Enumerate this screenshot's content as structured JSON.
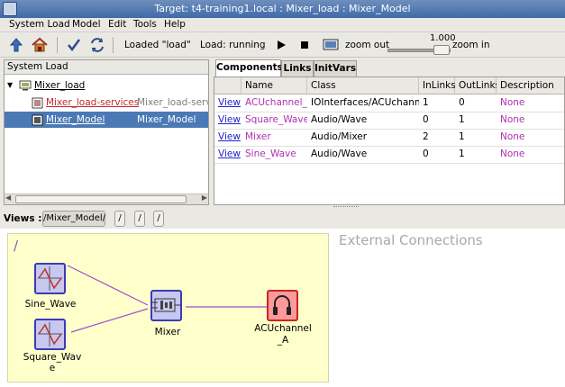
{
  "window": {
    "title": "Target: t4-training1.local : Mixer_load : Mixer_Model"
  },
  "menu": [
    "System Load",
    "Model",
    "Edit",
    "Tools",
    "Help"
  ],
  "toolbar": {
    "loaded_text": "Loaded \"load\"",
    "load_status": "Load: running",
    "zoom_out": "zoom out",
    "zoom_in": "zoom in",
    "zoom_value": "1.000",
    "zoom_level": 0.72
  },
  "left_panel": {
    "header": "System Load",
    "tree": [
      {
        "label": "Mixer_load",
        "secondary": ""
      },
      {
        "label": "Mixer_load-services",
        "secondary": "Mixer_load-service"
      },
      {
        "label": "Mixer_Model",
        "secondary": "Mixer_Model"
      }
    ]
  },
  "tabs": [
    "Components",
    "Links",
    "InitVars"
  ],
  "table": {
    "columns": [
      "",
      "Name",
      "Class",
      "InLinks",
      "OutLinks",
      "Description"
    ],
    "rows": [
      {
        "action": "View",
        "name": "ACUchannel_A",
        "class": "IOInterfaces/ACUchannel",
        "inlinks": "1",
        "outlinks": "0",
        "description": "None"
      },
      {
        "action": "View",
        "name": "Square_Wave",
        "class": "Audio/Wave",
        "inlinks": "0",
        "outlinks": "1",
        "description": "None"
      },
      {
        "action": "View",
        "name": "Mixer",
        "class": "Audio/Mixer",
        "inlinks": "2",
        "outlinks": "1",
        "description": "None"
      },
      {
        "action": "View",
        "name": "Sine_Wave",
        "class": "Audio/Wave",
        "inlinks": "0",
        "outlinks": "1",
        "description": "None"
      }
    ]
  },
  "views": {
    "label": "Views :",
    "buttons": [
      "/Mixer_Model/",
      "/",
      "/",
      "/"
    ]
  },
  "diagram": {
    "path_label": "/",
    "external_title": "External Connections",
    "nodes": [
      {
        "label": "Sine_Wave",
        "icon": "wave-icon"
      },
      {
        "label": "Square_Wav\ne",
        "icon": "wave-icon"
      },
      {
        "label": "Mixer",
        "icon": "mixer-icon"
      },
      {
        "label": "ACUchannel\n_A",
        "icon": "headphones-icon"
      }
    ]
  },
  "colors": {
    "selection": "#4a79b5",
    "link": "#2222cc",
    "name": "#b030b0",
    "node": "#3b3bb5",
    "node_red": "#c2282b",
    "canvas_box": "#ffffcc"
  }
}
